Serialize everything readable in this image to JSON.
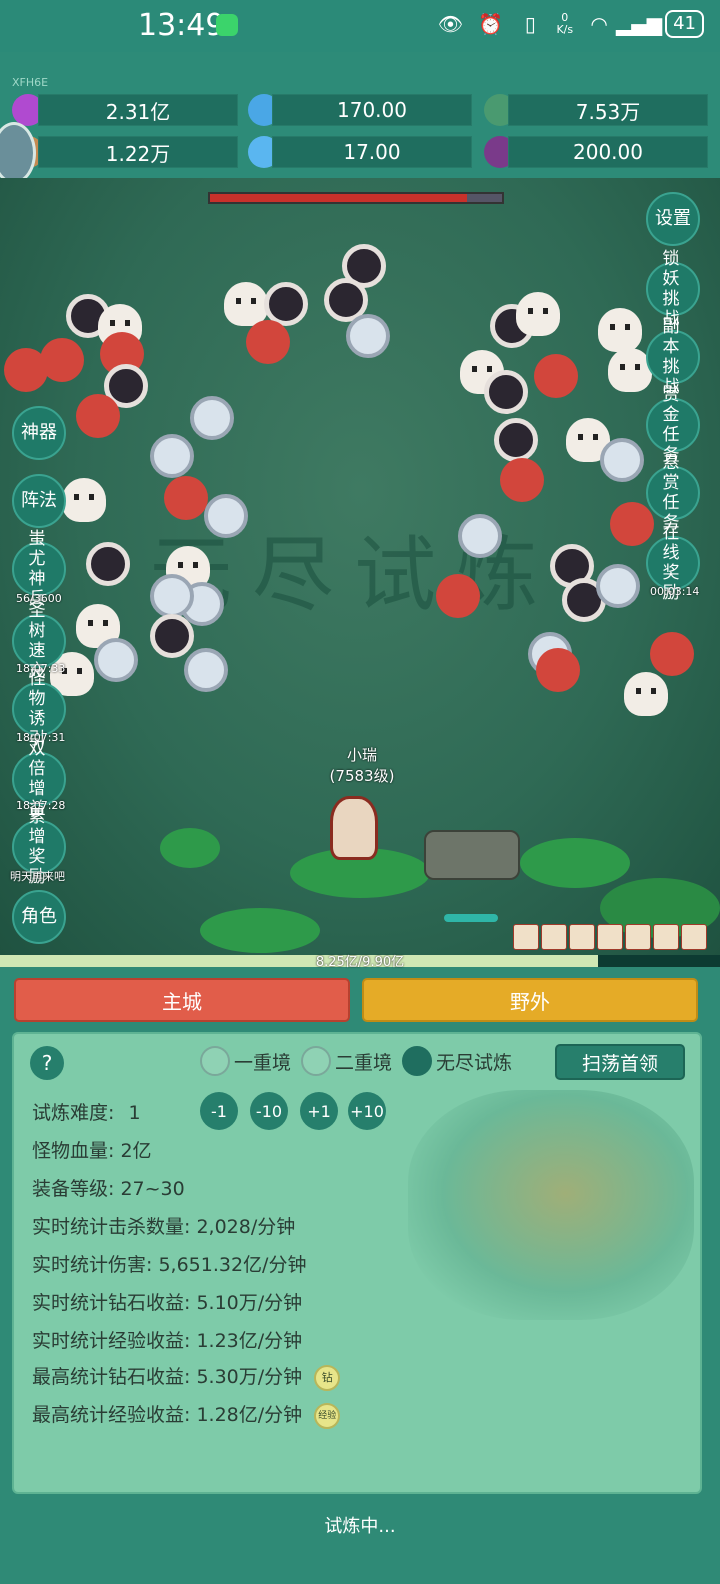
{
  "status_bar": {
    "time": "13:49",
    "network_speed_value": "0",
    "network_speed_unit": "K/s",
    "battery": "41"
  },
  "currencies": {
    "tag": "XFH6E",
    "row1": [
      {
        "icon": "purple-gem-icon",
        "value": "2.31亿"
      },
      {
        "icon": "blue-crystal-icon",
        "value": "170.00"
      },
      {
        "icon": "globe-icon",
        "value": "7.53万"
      }
    ],
    "row2": [
      {
        "icon": "gear-shell-icon",
        "value": "1.22万"
      },
      {
        "icon": "ice-shard-icon",
        "value": "17.00"
      },
      {
        "icon": "purple-bag-icon",
        "value": "200.00"
      }
    ]
  },
  "game": {
    "watermark": "无尽试炼",
    "boss_hp_fraction": 0.88,
    "hero_name": "小瑞",
    "hero_level": "(7583级)",
    "exp_text": "8.25亿/9.90亿",
    "exp_fraction": 0.83
  },
  "left_menu": [
    {
      "label": "神器",
      "sub": ""
    },
    {
      "label": "阵法",
      "sub": ""
    },
    {
      "label": "蚩尤神兵",
      "sub": "56/3600"
    },
    {
      "label": "圣树速充",
      "sub": "18:07:33"
    },
    {
      "label": "怪物诱引",
      "sub": "18:07:31"
    },
    {
      "label": "双倍增益",
      "sub": "18:07:28"
    },
    {
      "label": "累增奖励",
      "sub": "明天再来吧"
    },
    {
      "label": "角色",
      "sub": ""
    }
  ],
  "right_menu": [
    {
      "label": "设置",
      "sub": ""
    },
    {
      "label": "锁妖挑战",
      "sub": ""
    },
    {
      "label": "副本挑战",
      "sub": ""
    },
    {
      "label": "赏金任务",
      "sub": ""
    },
    {
      "label": "悬赏任务",
      "sub": ""
    },
    {
      "label": "在线奖励",
      "sub": "00:03:14"
    }
  ],
  "tabs": {
    "city": "主城",
    "field": "野外"
  },
  "panel": {
    "help": "?",
    "modes": [
      {
        "label": "一重境",
        "selected": false
      },
      {
        "label": "二重境",
        "selected": false
      },
      {
        "label": "无尽试炼",
        "selected": true
      }
    ],
    "sweep_label": "扫荡首领",
    "difficulty_label": "试炼难度:",
    "difficulty_value": "1",
    "steppers": [
      "-1",
      "-10",
      "+1",
      "+10"
    ],
    "monster_hp": "怪物血量: 2亿",
    "equip_level": "装备等级: 27~30",
    "kills": "实时统计击杀数量: 2,028/分钟",
    "damage": "实时统计伤害: 5,651.32亿/分钟",
    "diamond_income": "实时统计钻石收益: 5.10万/分钟",
    "exp_income": "实时统计经验收益: 1.23亿/分钟",
    "max_diamond": "最高统计钻石收益: 5.30万/分钟",
    "max_diamond_badge": "钻",
    "max_exp": "最高统计经验收益: 1.28亿/分钟",
    "max_exp_badge": "经验"
  },
  "footer_status": "试炼中..."
}
